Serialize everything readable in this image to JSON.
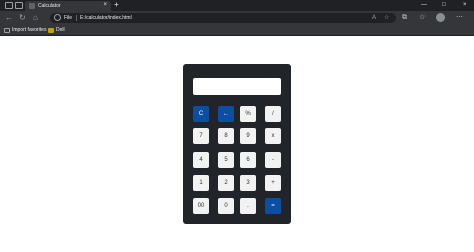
{
  "browser": {
    "tab": {
      "title": "Calculator",
      "close_glyph": "×"
    },
    "new_tab_glyph": "+",
    "window_controls": [
      "—",
      "□",
      "×"
    ],
    "nav": {
      "back_glyph": "←",
      "forward_glyph": "→",
      "reload_glyph": "↻",
      "home_glyph": "⌂"
    },
    "address": {
      "scheme_label": "File",
      "url": "E:/calculator/index.html"
    },
    "toolbar_icons": [
      "A",
      "☆",
      "⧉",
      "☆",
      "⋯"
    ],
    "bookmarks": [
      {
        "label": "Import favorites"
      },
      {
        "label": "Dell"
      }
    ]
  },
  "calculator": {
    "display_value": "",
    "rows": [
      [
        {
          "label": "C",
          "name": "clear"
        },
        {
          "label": "←",
          "name": "backspace"
        },
        {
          "label": "%",
          "name": "percent"
        },
        {
          "label": "/",
          "name": "divide"
        }
      ],
      [
        {
          "label": "7",
          "name": "7"
        },
        {
          "label": "8",
          "name": "8"
        },
        {
          "label": "9",
          "name": "9"
        },
        {
          "label": "x",
          "name": "multiply"
        }
      ],
      [
        {
          "label": "4",
          "name": "4"
        },
        {
          "label": "5",
          "name": "5"
        },
        {
          "label": "6",
          "name": "6"
        },
        {
          "label": "-",
          "name": "minus"
        }
      ],
      [
        {
          "label": "1",
          "name": "1"
        },
        {
          "label": "2",
          "name": "2"
        },
        {
          "label": "3",
          "name": "3"
        },
        {
          "label": "+",
          "name": "plus"
        }
      ],
      [
        {
          "label": "00",
          "name": "00"
        },
        {
          "label": "0",
          "name": "0"
        },
        {
          "label": ".",
          "name": "decimal"
        },
        {
          "label": "=",
          "name": "equals"
        }
      ]
    ],
    "colors": {
      "body": "#212428",
      "key": "#f2f2f2",
      "accent": "#0b4ea2"
    },
    "accent_keys": [
      "clear",
      "backspace",
      "equals"
    ]
  }
}
